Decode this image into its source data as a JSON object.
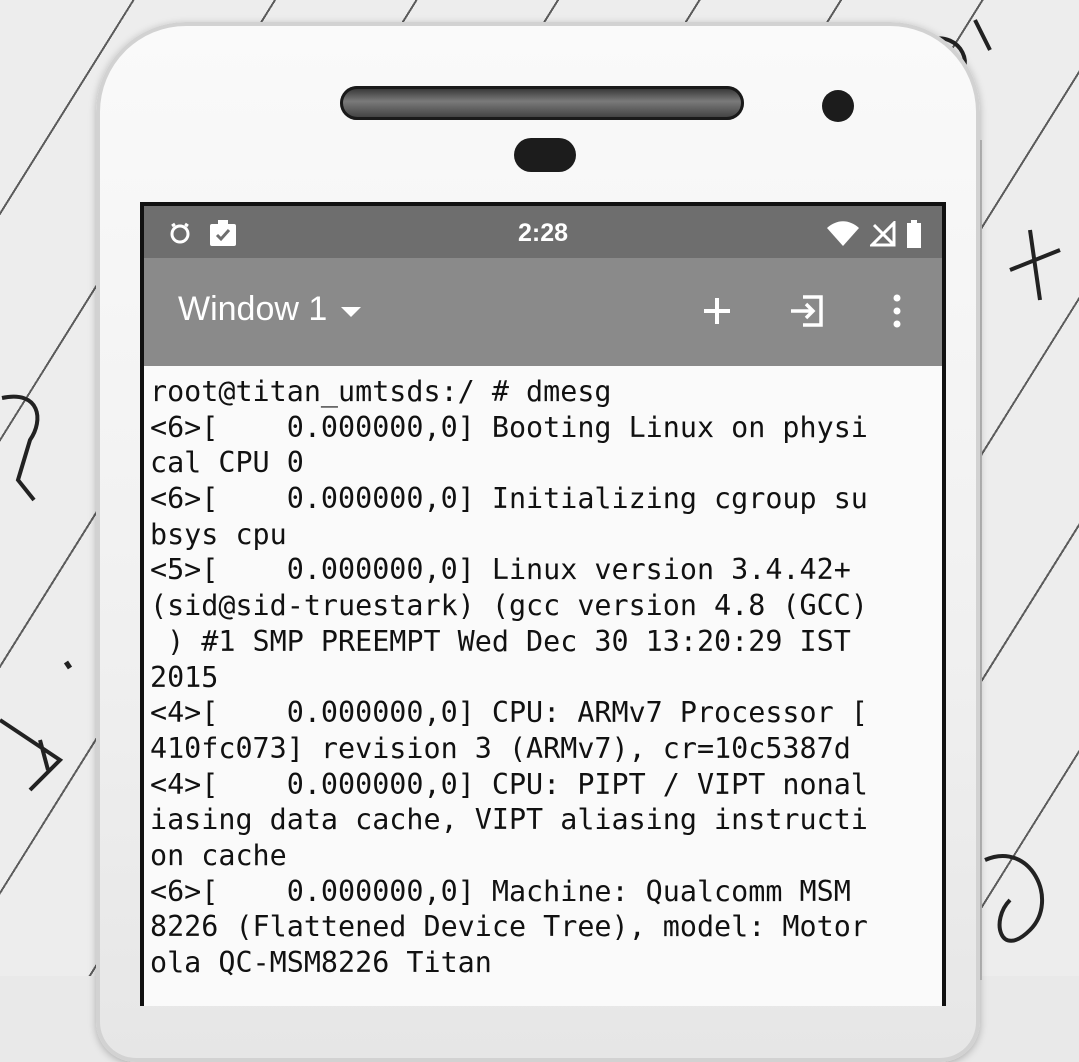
{
  "status_bar": {
    "time": "2:28",
    "left_icons": [
      "alarm-icon",
      "clipboard-check-icon"
    ],
    "right_icons": [
      "wifi-icon",
      "no-signal-icon",
      "battery-icon"
    ]
  },
  "toolbar": {
    "window_label": "Window 1",
    "dropdown_icon": "caret-down-icon",
    "actions": [
      {
        "name": "add-window-button",
        "icon": "plus-icon"
      },
      {
        "name": "switch-window-button",
        "icon": "enter-icon"
      },
      {
        "name": "overflow-menu-button",
        "icon": "more-vert-icon"
      }
    ]
  },
  "terminal": {
    "lines": [
      "root@titan_umtsds:/ # dmesg",
      "<6>[    0.000000,0] Booting Linux on physi",
      "cal CPU 0",
      "<6>[    0.000000,0] Initializing cgroup su",
      "bsys cpu",
      "<5>[    0.000000,0] Linux version 3.4.42+",
      "(sid@sid-truestark) (gcc version 4.8 (GCC)",
      " ) #1 SMP PREEMPT Wed Dec 30 13:20:29 IST",
      "2015",
      "<4>[    0.000000,0] CPU: ARMv7 Processor [",
      "410fc073] revision 3 (ARMv7), cr=10c5387d",
      "<4>[    0.000000,0] CPU: PIPT / VIPT nonal",
      "iasing data cache, VIPT aliasing instructi",
      "on cache",
      "<6>[    0.000000,0] Machine: Qualcomm MSM",
      "8226 (Flattened Device Tree), model: Motor",
      "ola QC-MSM8226 Titan"
    ]
  },
  "colors": {
    "status_bar": "#6e6e6e",
    "toolbar": "#8a8a8a",
    "terminal_bg": "#fafafa",
    "terminal_fg": "#111111"
  }
}
